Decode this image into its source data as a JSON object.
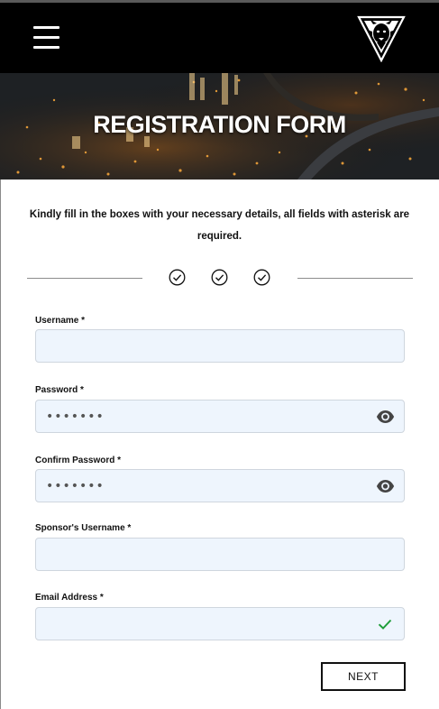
{
  "header": {
    "menu_icon": "hamburger-menu-icon",
    "logo_icon": "lion-triangle-logo-icon"
  },
  "hero": {
    "title": "REGISTRATION FORM"
  },
  "intro": {
    "text_line1": "Kindly fill in the boxes with your necessary details, all fields with asterisk are",
    "text_line2": "required."
  },
  "steps": {
    "icons": [
      "check-circle-icon",
      "check-circle-icon",
      "check-circle-icon"
    ]
  },
  "form": {
    "username": {
      "label": "Username *",
      "value": "",
      "placeholder": ""
    },
    "password": {
      "label": "Password *",
      "value": "",
      "placeholder": "•••••••",
      "icon": "eye-icon"
    },
    "confirm_password": {
      "label": "Confirm Password *",
      "value": "",
      "placeholder": "•••••••",
      "icon": "eye-icon"
    },
    "sponsor_username": {
      "label": "Sponsor's Username *",
      "value": "",
      "placeholder": ""
    },
    "email": {
      "label": "Email Address *",
      "value": "",
      "placeholder": "",
      "icon": "checkmark-icon",
      "valid_color": "#1e9e3a"
    }
  },
  "actions": {
    "next_label": "NEXT"
  },
  "colors": {
    "header_bg": "#000000",
    "field_bg": "#eef5fd",
    "field_border": "#cfd6de"
  }
}
